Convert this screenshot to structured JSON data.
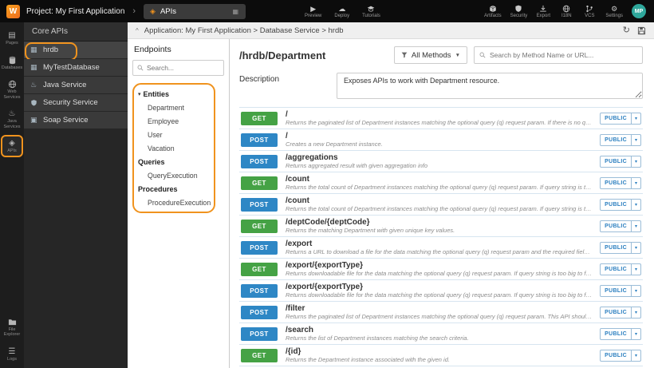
{
  "colors": {
    "accent": "#f0931e",
    "get": "#45a245",
    "post": "#2e87c5",
    "access": "#2b7fc0",
    "avatar": "#2fa79b"
  },
  "topbar": {
    "project_label": "Project: My First Application",
    "tab_label": "APIs",
    "actions_center": {
      "preview": "Preview",
      "deploy": "Deploy",
      "tutorials": "Tutorials"
    },
    "actions_right": {
      "artifacts": "Artifacts",
      "security": "Security",
      "export": "Export",
      "i18n": "I18N",
      "vcs": "VCS",
      "settings": "Settings"
    },
    "avatar_initials": "MP"
  },
  "rail": {
    "items": [
      {
        "label": "Pages"
      },
      {
        "label": "Databases"
      },
      {
        "label": "Web Services"
      },
      {
        "label": "Java Services"
      },
      {
        "label": "APIs"
      },
      {
        "label": "File Explorer"
      },
      {
        "label": "Logs"
      }
    ]
  },
  "sidebar": {
    "title": "Core APIs",
    "items": [
      {
        "label": "hrdb"
      },
      {
        "label": "MyTestDatabase"
      },
      {
        "label": "Java Service"
      },
      {
        "label": "Security Service"
      },
      {
        "label": "Soap Service"
      }
    ]
  },
  "endpoints": {
    "title": "Endpoints",
    "search_placeholder": "Search...",
    "tree": {
      "entities_header": "Entities",
      "entities": [
        "Department",
        "Employee",
        "User",
        "Vacation"
      ],
      "queries_header": "Queries",
      "queries": [
        "QueryExecution"
      ],
      "procedures_header": "Procedures",
      "procedures": [
        "ProcedureExecution"
      ]
    }
  },
  "main": {
    "breadcrumb": "Application: My First Application > Database Service > hrdb",
    "title": "/hrdb/Department",
    "methods_filter_label": "All Methods",
    "search_placeholder": "Search by Method Name or URL...",
    "description_label": "Description",
    "description_value": "Exposes APIs to work with Department resource.",
    "rows": [
      {
        "method": "GET",
        "path": "/",
        "desc": "Returns the paginated list of Department instances matching the optional query (q) request param. If there is no query pro...",
        "access": "PUBLIC"
      },
      {
        "method": "POST",
        "path": "/",
        "desc": "Creates a new Department instance.",
        "access": "PUBLIC"
      },
      {
        "method": "POST",
        "path": "/aggregations",
        "desc": "Returns aggregated result with given aggregation info",
        "access": "PUBLIC"
      },
      {
        "method": "GET",
        "path": "/count",
        "desc": "Returns the total count of Department instances matching the optional query (q) request param. If query string is too big t...",
        "access": "PUBLIC"
      },
      {
        "method": "POST",
        "path": "/count",
        "desc": "Returns the total count of Department instances matching the optional query (q) request param. If query string is too big t...",
        "access": "PUBLIC"
      },
      {
        "method": "GET",
        "path": "/deptCode/{deptCode}",
        "desc": "Returns the matching Department with given unique key values.",
        "access": "PUBLIC"
      },
      {
        "method": "POST",
        "path": "/export",
        "desc": "Returns a URL to download a file for the data matching the optional query (q) request param and the required fields provid...",
        "access": "PUBLIC"
      },
      {
        "method": "GET",
        "path": "/export/{exportType}",
        "desc": "Returns downloadable file for the data matching the optional query (q) request param. If query string is too big to fit in GET...",
        "access": "PUBLIC"
      },
      {
        "method": "POST",
        "path": "/export/{exportType}",
        "desc": "Returns downloadable file for the data matching the optional query (q) request param. If query string is too big to fit in GET...",
        "access": "PUBLIC"
      },
      {
        "method": "POST",
        "path": "/filter",
        "desc": "Returns the paginated list of Department instances matching the optional query (q) request param. This API should be use...",
        "access": "PUBLIC"
      },
      {
        "method": "POST",
        "path": "/search",
        "desc": "Returns the list of Department instances matching the search criteria.",
        "access": "PUBLIC"
      },
      {
        "method": "GET",
        "path": "/{id}",
        "desc": "Returns the Department instance associated with the given id.",
        "access": "PUBLIC"
      }
    ]
  }
}
